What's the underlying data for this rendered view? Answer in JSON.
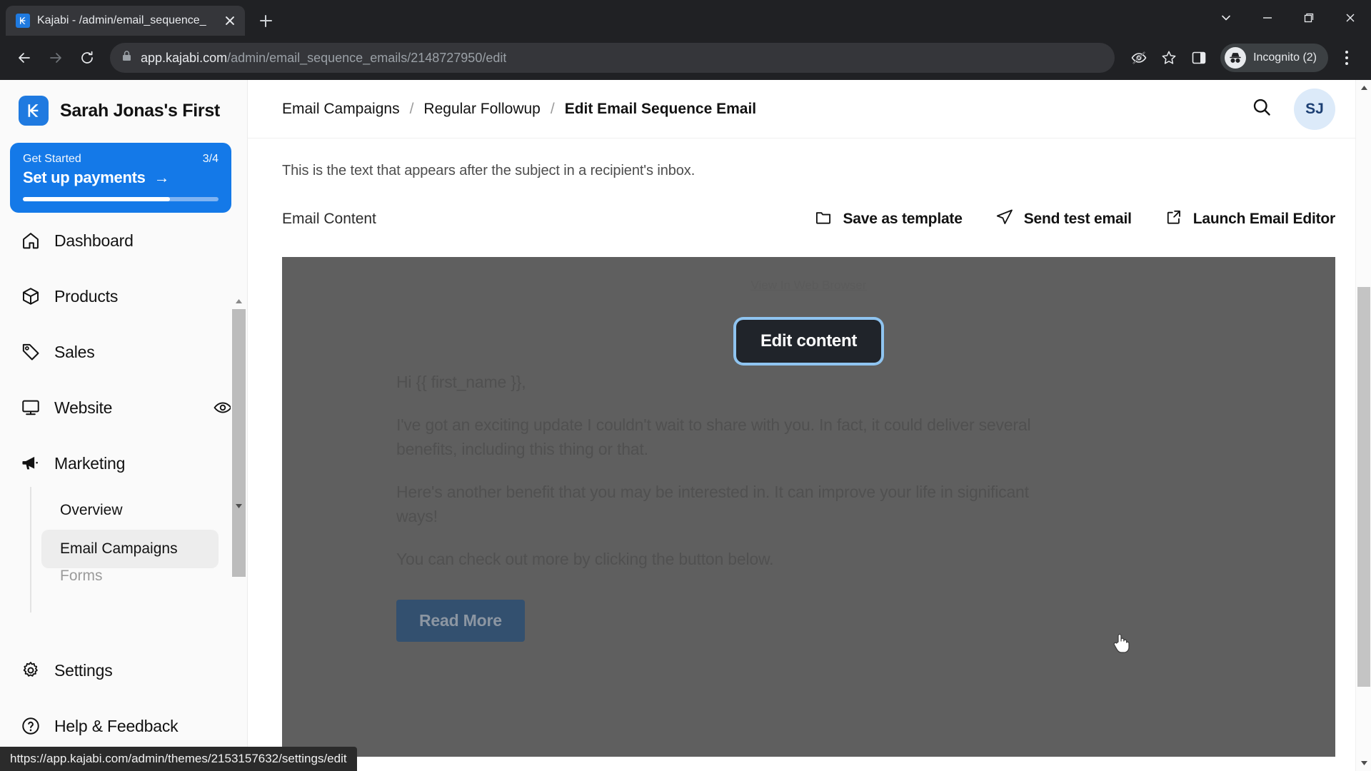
{
  "browser": {
    "tab": {
      "title": "Kajabi - /admin/email_sequence_",
      "favicon_name": "kajabi-favicon"
    },
    "newtab_tooltip": "New tab",
    "url_domain": "app.kajabi.com",
    "url_path": "/admin/email_sequence_emails/2148727950/edit",
    "profile_label": "Incognito (2)",
    "window_controls": [
      "tab-search",
      "minimize",
      "maximize",
      "close"
    ],
    "status_url": "https://app.kajabi.com/admin/themes/2153157632/settings/edit"
  },
  "sidebar": {
    "brand_name": "Sarah Jonas's First",
    "get_started": {
      "label": "Get Started",
      "count": "3/4",
      "task": "Set up payments",
      "arrow": "→",
      "progress_percent": 75
    },
    "items": [
      {
        "label": "Dashboard",
        "icon": "home-icon"
      },
      {
        "label": "Products",
        "icon": "box-icon"
      },
      {
        "label": "Sales",
        "icon": "tag-icon"
      },
      {
        "label": "Website",
        "icon": "monitor-icon",
        "trailing_icon": "eye-icon"
      },
      {
        "label": "Marketing",
        "icon": "megaphone-icon"
      }
    ],
    "sub_items": [
      {
        "label": "Overview",
        "active": false
      },
      {
        "label": "Email Campaigns",
        "active": true
      },
      {
        "label": "Forms",
        "active": false
      }
    ],
    "bottom_items": [
      {
        "label": "Settings",
        "icon": "gear-icon"
      },
      {
        "label": "Help & Feedback",
        "icon": "question-circle-icon"
      }
    ]
  },
  "header": {
    "breadcrumb": [
      {
        "label": "Email Campaigns",
        "current": false
      },
      {
        "label": "Regular Followup",
        "current": false
      },
      {
        "label": "Edit Email Sequence Email",
        "current": true
      }
    ],
    "separator": "/",
    "search_icon": "search-icon",
    "avatar_initials": "SJ"
  },
  "main": {
    "helper_text": "This is the text that appears after the subject in a recipient's inbox.",
    "section_title": "Email Content",
    "actions": [
      {
        "label": "Save as template",
        "icon": "folder-icon"
      },
      {
        "label": "Send test email",
        "icon": "paper-plane-icon"
      },
      {
        "label": "Launch Email Editor",
        "icon": "external-link-icon"
      }
    ]
  },
  "email_preview": {
    "view_in_browser": "View In Web Browser",
    "edit_button": "Edit content",
    "paragraphs": [
      "Hi {{ first_name }},",
      "I've got an exciting update I couldn't wait to share with you. In fact, it could deliver several benefits, including this thing or that.",
      "Here's another benefit that you may be interested in. It can improve your life in significant ways!",
      "You can check out more by clicking the button below."
    ],
    "cta_label": "Read More"
  },
  "colors": {
    "brand_blue": "#1479e8",
    "preview_bg": "#5f5f5f",
    "edit_button_bg": "#20242a",
    "focus_ring": "#8fc4f0",
    "cta_bg": "#33506f",
    "avatar_bg": "#dceaf9"
  }
}
